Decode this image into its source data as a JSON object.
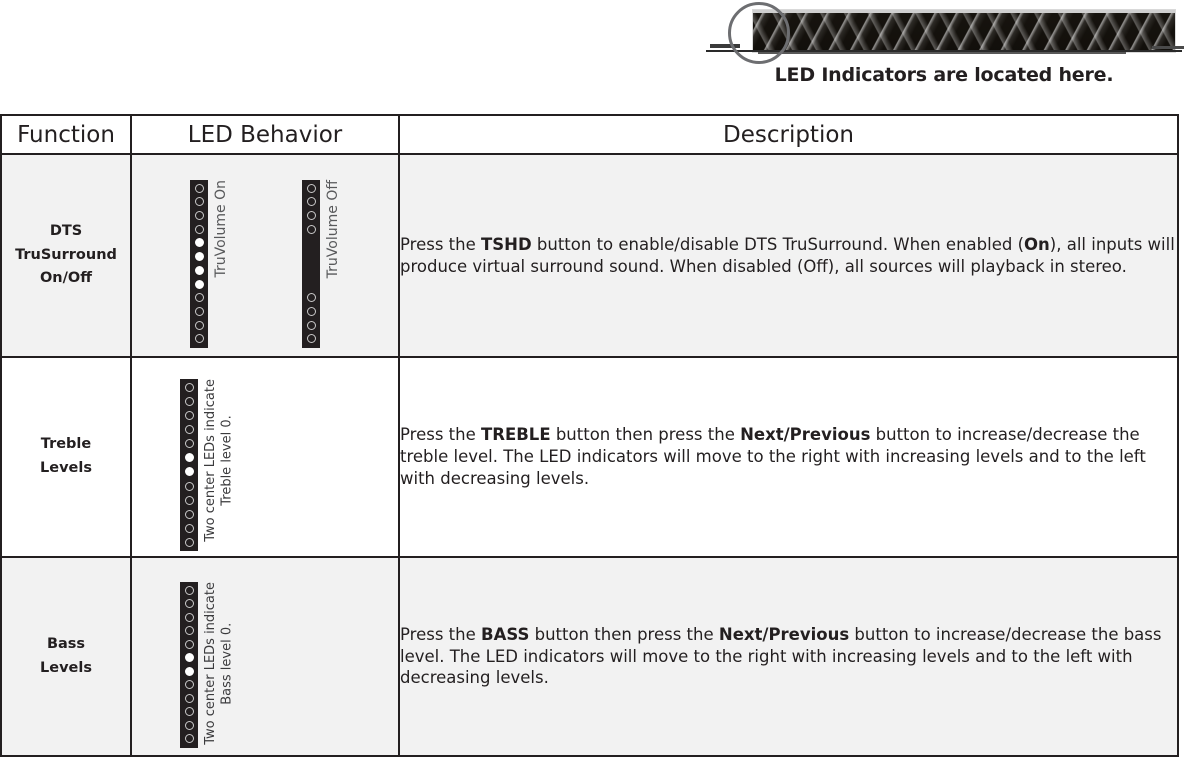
{
  "illustration": {
    "device_name": "soundbar",
    "callout_icon": "circle-callout-icon",
    "caption": "LED Indicators are located here."
  },
  "table": {
    "headers": {
      "function": "Function",
      "led_behavior": "LED Behavior",
      "description": "Description"
    },
    "rows": [
      {
        "function": "DTS\nTruSurround\nOn/Off",
        "led_groups": [
          {
            "label": "TruVolume On",
            "led_count": 12,
            "led_states": [
              "off",
              "off",
              "off",
              "off",
              "on",
              "on",
              "on",
              "on",
              "off",
              "off",
              "off",
              "off"
            ]
          },
          {
            "label": "TruVolume Off",
            "led_count": 12,
            "led_states": [
              "off",
              "off",
              "off",
              "off",
              "hidden",
              "hidden",
              "hidden",
              "hidden",
              "off",
              "off",
              "off",
              "off"
            ]
          }
        ],
        "description_parts": [
          {
            "text": "Press the ",
            "bold": false
          },
          {
            "text": "TSHD",
            "bold": true
          },
          {
            "text": " button to enable/disable DTS TruSurround. When enabled (",
            "bold": false
          },
          {
            "text": "On",
            "bold": true
          },
          {
            "text": "), all inputs will produce virtual surround sound. When disabled (Off), all sources will playback in stereo.",
            "bold": false
          }
        ]
      },
      {
        "function": "Treble\nLevels",
        "led_groups": [
          {
            "label": "Two center LEDs indicate\nTreble level 0.",
            "led_count": 12,
            "led_states": [
              "off",
              "off",
              "off",
              "off",
              "off",
              "on",
              "on",
              "off",
              "off",
              "off",
              "off",
              "off"
            ]
          }
        ],
        "description_parts": [
          {
            "text": "Press the ",
            "bold": false
          },
          {
            "text": "TREBLE",
            "bold": true
          },
          {
            "text": " button then press the ",
            "bold": false
          },
          {
            "text": "Next/Previous",
            "bold": true
          },
          {
            "text": " button to increase/decrease the treble level. The LED indicators will move to the right with increasing levels and to the left with decreasing levels.",
            "bold": false
          }
        ]
      },
      {
        "function": "Bass\nLevels",
        "led_groups": [
          {
            "label": "Two center LEDs indicate\nBass level 0.",
            "led_count": 12,
            "led_states": [
              "off",
              "off",
              "off",
              "off",
              "off",
              "on",
              "on",
              "off",
              "off",
              "off",
              "off",
              "off"
            ]
          }
        ],
        "description_parts": [
          {
            "text": "Press the ",
            "bold": false
          },
          {
            "text": "BASS",
            "bold": true
          },
          {
            "text": " button then press the ",
            "bold": false
          },
          {
            "text": "Next/Previous",
            "bold": true
          },
          {
            "text": " button to increase/decrease the bass level. The LED indicators will move to the right with increasing levels and to the left with decreasing levels.",
            "bold": false
          }
        ]
      }
    ]
  },
  "colors": {
    "ink": "#231f20",
    "row_shade": "#f2f2f2",
    "strip": "#231f20",
    "led_on": "#ffffff",
    "led_off_ring": "#c9c9c9",
    "callout": "#6d6e71"
  }
}
